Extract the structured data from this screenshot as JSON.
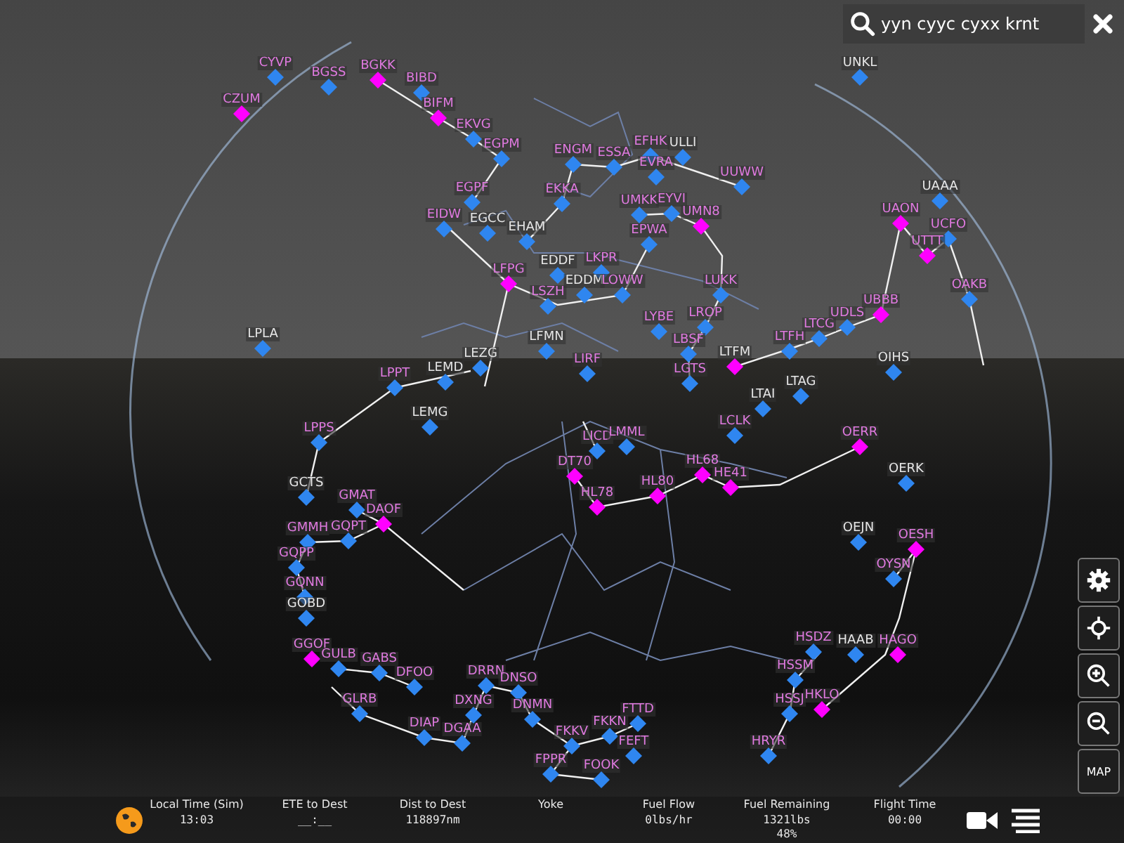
{
  "search": {
    "value": "yyn cyyc cyxx krnt"
  },
  "airports": [
    {
      "code": "CYVP",
      "color": "#2f86f0",
      "kind": "pink"
    },
    {
      "code": "UNKL",
      "color": "#2f86f0",
      "kind": "white"
    },
    {
      "code": "CZUM",
      "color": "#ff00ff",
      "kind": "pink"
    },
    {
      "code": "BGSS",
      "color": "#2f86f0",
      "kind": "pink"
    },
    {
      "code": "BGKK",
      "color": "#ff00ff",
      "kind": "pink"
    },
    {
      "code": "BIBD",
      "color": "#2f86f0",
      "kind": "pink"
    },
    {
      "code": "BIFM",
      "color": "#ff00ff",
      "kind": "pink"
    },
    {
      "code": "EKVG",
      "color": "#2f86f0",
      "kind": "pink"
    },
    {
      "code": "EGPM",
      "color": "#2f86f0",
      "kind": "pink"
    },
    {
      "code": "EGPF",
      "color": "#2f86f0",
      "kind": "pink"
    },
    {
      "code": "ENGM",
      "color": "#2f86f0",
      "kind": "pink"
    },
    {
      "code": "ESSA",
      "color": "#2f86f0",
      "kind": "pink"
    },
    {
      "code": "EFHK",
      "color": "#2f86f0",
      "kind": "pink"
    },
    {
      "code": "ULLI",
      "color": "#2f86f0",
      "kind": "white"
    },
    {
      "code": "UUWW",
      "color": "#2f86f0",
      "kind": "pink"
    },
    {
      "code": "EVRA",
      "color": "#2f86f0",
      "kind": "pink"
    },
    {
      "code": "UMKK",
      "color": "#2f86f0",
      "kind": "pink"
    },
    {
      "code": "EYVI",
      "color": "#2f86f0",
      "kind": "pink"
    },
    {
      "code": "UMN8",
      "color": "#ff00ff",
      "kind": "pink"
    },
    {
      "code": "EPWA",
      "color": "#2f86f0",
      "kind": "pink"
    },
    {
      "code": "EKKA",
      "color": "#2f86f0",
      "kind": "pink"
    },
    {
      "code": "EIDW",
      "color": "#2f86f0",
      "kind": "pink"
    },
    {
      "code": "EGCC",
      "color": "#2f86f0",
      "kind": "white"
    },
    {
      "code": "EHAM",
      "color": "#2f86f0",
      "kind": "white"
    },
    {
      "code": "LFPG",
      "color": "#ff00ff",
      "kind": "pink"
    },
    {
      "code": "EDDF",
      "color": "#2f86f0",
      "kind": "white"
    },
    {
      "code": "LKPR",
      "color": "#2f86f0",
      "kind": "pink"
    },
    {
      "code": "EDDM",
      "color": "#2f86f0",
      "kind": "white"
    },
    {
      "code": "LOWW",
      "color": "#2f86f0",
      "kind": "pink"
    },
    {
      "code": "LSZH",
      "color": "#2f86f0",
      "kind": "pink"
    },
    {
      "code": "LUKK",
      "color": "#2f86f0",
      "kind": "pink"
    },
    {
      "code": "LYBE",
      "color": "#2f86f0",
      "kind": "pink"
    },
    {
      "code": "LROP",
      "color": "#2f86f0",
      "kind": "pink"
    },
    {
      "code": "LBSF",
      "color": "#2f86f0",
      "kind": "pink"
    },
    {
      "code": "LGTS",
      "color": "#2f86f0",
      "kind": "pink"
    },
    {
      "code": "LTFM",
      "color": "#ff00ff",
      "kind": "white"
    },
    {
      "code": "LTFH",
      "color": "#2f86f0",
      "kind": "pink"
    },
    {
      "code": "LTCG",
      "color": "#2f86f0",
      "kind": "pink"
    },
    {
      "code": "UDLS",
      "color": "#2f86f0",
      "kind": "pink"
    },
    {
      "code": "UBBB",
      "color": "#ff00ff",
      "kind": "pink"
    },
    {
      "code": "UAAA",
      "color": "#2f86f0",
      "kind": "white"
    },
    {
      "code": "UAON",
      "color": "#ff00ff",
      "kind": "pink"
    },
    {
      "code": "UCFO",
      "color": "#2f86f0",
      "kind": "pink"
    },
    {
      "code": "UTTT",
      "color": "#ff00ff",
      "kind": "pink"
    },
    {
      "code": "OAKB",
      "color": "#2f86f0",
      "kind": "pink"
    },
    {
      "code": "OIHS",
      "color": "#2f86f0",
      "kind": "white"
    },
    {
      "code": "LTAI",
      "color": "#2f86f0",
      "kind": "white"
    },
    {
      "code": "LTAG",
      "color": "#2f86f0",
      "kind": "white"
    },
    {
      "code": "LIRF",
      "color": "#2f86f0",
      "kind": "pink"
    },
    {
      "code": "LPLA",
      "color": "#2f86f0",
      "kind": "white"
    },
    {
      "code": "LFMN",
      "color": "#2f86f0",
      "kind": "white"
    },
    {
      "code": "LEZG",
      "color": "#2f86f0",
      "kind": "white"
    },
    {
      "code": "LEMD",
      "color": "#2f86f0",
      "kind": "white"
    },
    {
      "code": "LPPT",
      "color": "#2f86f0",
      "kind": "pink"
    },
    {
      "code": "LEMG",
      "color": "#2f86f0",
      "kind": "white"
    },
    {
      "code": "LPPS",
      "color": "#2f86f0",
      "kind": "pink"
    },
    {
      "code": "GCTS",
      "color": "#2f86f0",
      "kind": "white"
    },
    {
      "code": "GMAT",
      "color": "#2f86f0",
      "kind": "pink"
    },
    {
      "code": "DAOF",
      "color": "#ff00ff",
      "kind": "pink"
    },
    {
      "code": "GMMH",
      "color": "#2f86f0",
      "kind": "pink"
    },
    {
      "code": "GQPT",
      "color": "#2f86f0",
      "kind": "pink"
    },
    {
      "code": "GQPP",
      "color": "#2f86f0",
      "kind": "pink"
    },
    {
      "code": "GQNN",
      "color": "#2f86f0",
      "kind": "pink"
    },
    {
      "code": "GOBD",
      "color": "#2f86f0",
      "kind": "white"
    },
    {
      "code": "GGOF",
      "color": "#ff00ff",
      "kind": "pink"
    },
    {
      "code": "GULB",
      "color": "#2f86f0",
      "kind": "pink"
    },
    {
      "code": "GABS",
      "color": "#2f86f0",
      "kind": "pink"
    },
    {
      "code": "DFOO",
      "color": "#2f86f0",
      "kind": "pink"
    },
    {
      "code": "GLRB",
      "color": "#2f86f0",
      "kind": "pink"
    },
    {
      "code": "DIAP",
      "color": "#2f86f0",
      "kind": "pink"
    },
    {
      "code": "DGAA",
      "color": "#2f86f0",
      "kind": "pink"
    },
    {
      "code": "DXNG",
      "color": "#2f86f0",
      "kind": "pink"
    },
    {
      "code": "DRRN",
      "color": "#2f86f0",
      "kind": "pink"
    },
    {
      "code": "DNSO",
      "color": "#2f86f0",
      "kind": "pink"
    },
    {
      "code": "DNMN",
      "color": "#2f86f0",
      "kind": "pink"
    },
    {
      "code": "FKKV",
      "color": "#2f86f0",
      "kind": "pink"
    },
    {
      "code": "FKKN",
      "color": "#2f86f0",
      "kind": "pink"
    },
    {
      "code": "FTTD",
      "color": "#2f86f0",
      "kind": "pink"
    },
    {
      "code": "FEFT",
      "color": "#2f86f0",
      "kind": "pink"
    },
    {
      "code": "FOOK",
      "color": "#2f86f0",
      "kind": "pink"
    },
    {
      "code": "FPPR",
      "color": "#2f86f0",
      "kind": "pink"
    },
    {
      "code": "HSDZ",
      "color": "#2f86f0",
      "kind": "pink"
    },
    {
      "code": "HAAB",
      "color": "#2f86f0",
      "kind": "white"
    },
    {
      "code": "HAGO",
      "color": "#ff00ff",
      "kind": "pink"
    },
    {
      "code": "HSSM",
      "color": "#2f86f0",
      "kind": "pink"
    },
    {
      "code": "HKLO",
      "color": "#ff00ff",
      "kind": "pink"
    },
    {
      "code": "HSSJ",
      "color": "#2f86f0",
      "kind": "pink"
    },
    {
      "code": "HRYR",
      "color": "#2f86f0",
      "kind": "pink"
    },
    {
      "code": "OEJN",
      "color": "#2f86f0",
      "kind": "white"
    },
    {
      "code": "OERK",
      "color": "#2f86f0",
      "kind": "white"
    },
    {
      "code": "OESH",
      "color": "#ff00ff",
      "kind": "pink"
    },
    {
      "code": "OYSN",
      "color": "#2f86f0",
      "kind": "pink"
    },
    {
      "code": "HL68",
      "color": "#ff00ff",
      "kind": "pink"
    },
    {
      "code": "HE41",
      "color": "#ff00ff",
      "kind": "pink"
    },
    {
      "code": "HL80",
      "color": "#ff00ff",
      "kind": "pink"
    },
    {
      "code": "HL78",
      "color": "#ff00ff",
      "kind": "pink"
    },
    {
      "code": "DT70",
      "color": "#ff00ff",
      "kind": "pink"
    },
    {
      "code": "LICD",
      "color": "#2f86f0",
      "kind": "pink"
    },
    {
      "code": "LMML",
      "color": "#2f86f0",
      "kind": "pink"
    },
    {
      "code": "OERR",
      "color": "#ff00ff",
      "kind": "pink"
    },
    {
      "code": "LCLK",
      "color": "#2f86f0",
      "kind": "pink"
    }
  ],
  "map_button_label": "MAP",
  "status_bar": [
    {
      "label": "Local Time (Sim)",
      "values": [
        "13:03"
      ]
    },
    {
      "label": "ETE to Dest",
      "values": [
        "__:__"
      ]
    },
    {
      "label": "Dist to Dest",
      "values": [
        "118897nm"
      ]
    },
    {
      "label": "Yoke"
    },
    {
      "label": "Fuel Flow",
      "values": [
        "0lbs/hr"
      ]
    },
    {
      "label": "Fuel Remaining",
      "values": [
        "1321lbs",
        "48%"
      ]
    },
    {
      "label": "Flight Time",
      "values": [
        "00:00"
      ]
    }
  ]
}
